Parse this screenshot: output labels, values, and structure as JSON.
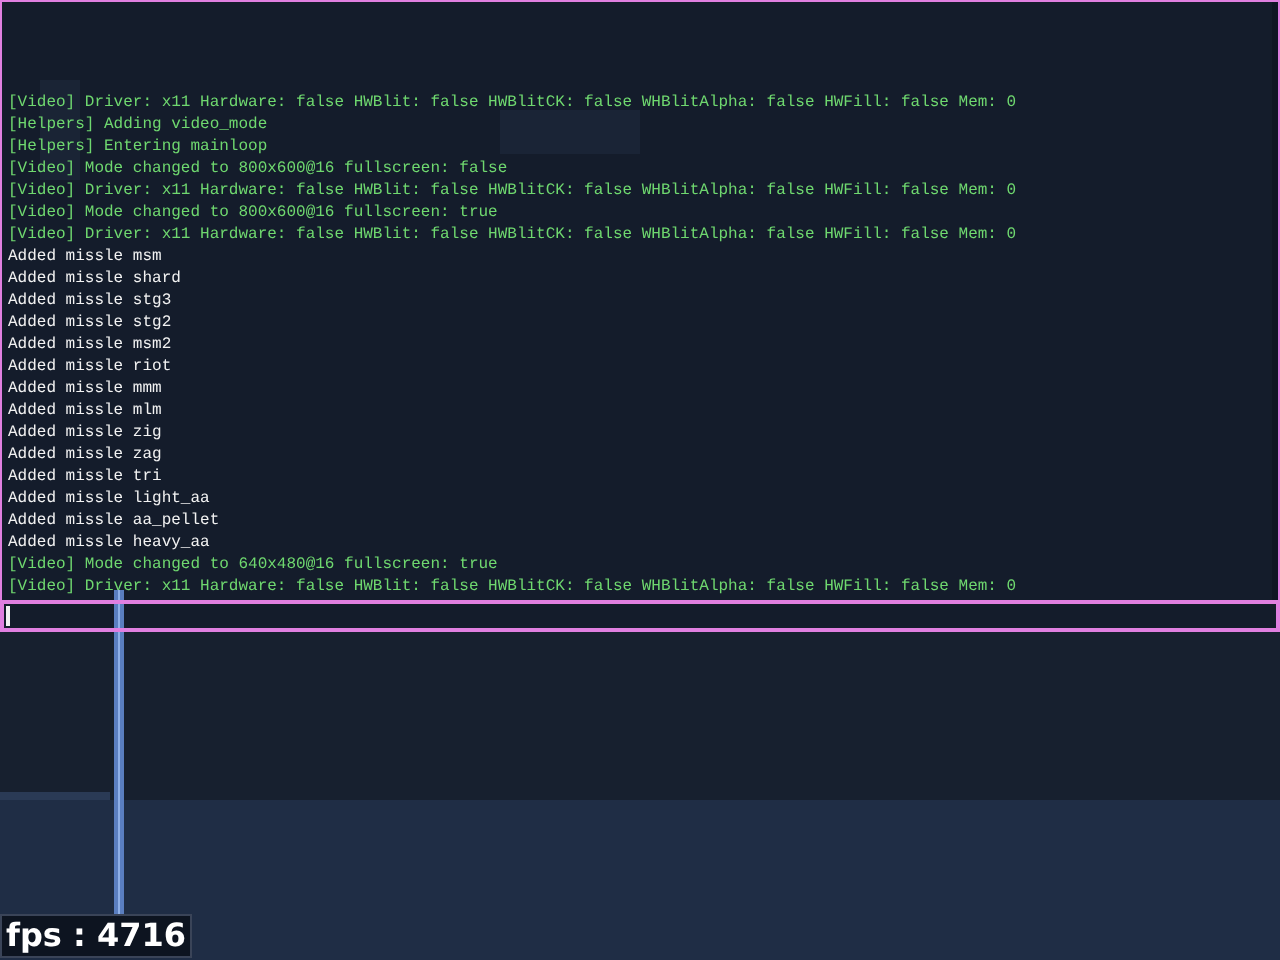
{
  "console": {
    "lines": [
      {
        "kind": "system",
        "text": "[Video] Driver: x11 Hardware: false HWBlit: false HWBlitCK: false WHBlitAlpha: false HWFill: false Mem: 0"
      },
      {
        "kind": "system",
        "text": "[Helpers] Adding video_mode"
      },
      {
        "kind": "system",
        "text": "[Helpers] Entering mainloop"
      },
      {
        "kind": "system",
        "text": "[Video] Mode changed to 800x600@16 fullscreen: false"
      },
      {
        "kind": "system",
        "text": "[Video] Driver: x11 Hardware: false HWBlit: false HWBlitCK: false WHBlitAlpha: false HWFill: false Mem: 0"
      },
      {
        "kind": "system",
        "text": "[Video] Mode changed to 800x600@16 fullscreen: true"
      },
      {
        "kind": "system",
        "text": "[Video] Driver: x11 Hardware: false HWBlit: false HWBlitCK: false WHBlitAlpha: false HWFill: false Mem: 0"
      },
      {
        "kind": "plain",
        "text": "Added missle msm"
      },
      {
        "kind": "plain",
        "text": "Added missle shard"
      },
      {
        "kind": "plain",
        "text": "Added missle stg3"
      },
      {
        "kind": "plain",
        "text": "Added missle stg2"
      },
      {
        "kind": "plain",
        "text": "Added missle msm2"
      },
      {
        "kind": "plain",
        "text": "Added missle riot"
      },
      {
        "kind": "plain",
        "text": "Added missle mmm"
      },
      {
        "kind": "plain",
        "text": "Added missle mlm"
      },
      {
        "kind": "plain",
        "text": "Added missle zig"
      },
      {
        "kind": "plain",
        "text": "Added missle zag"
      },
      {
        "kind": "plain",
        "text": "Added missle tri"
      },
      {
        "kind": "plain",
        "text": "Added missle light_aa"
      },
      {
        "kind": "plain",
        "text": "Added missle aa_pellet"
      },
      {
        "kind": "plain",
        "text": "Added missle heavy_aa"
      },
      {
        "kind": "system",
        "text": "[Video] Mode changed to 640x480@16 fullscreen: true"
      },
      {
        "kind": "system",
        "text": "[Video] Driver: x11 Hardware: false HWBlit: false HWBlitCK: false WHBlitAlpha: false HWFill: false Mem: 0"
      }
    ]
  },
  "fps_counter": {
    "text": "fps : 4716"
  }
}
